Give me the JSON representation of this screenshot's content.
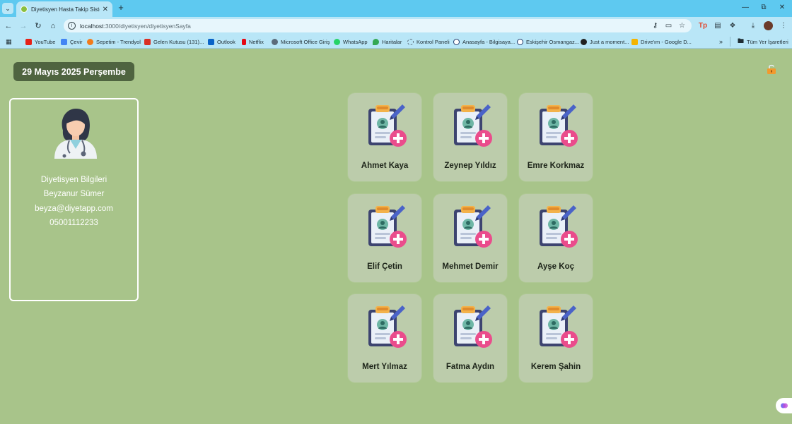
{
  "browser": {
    "tab_title": "Diyetisyen Hasta Takip Sistemi",
    "url_host": "localhost",
    "url_path": ":3000/diyetisyen/diyetisyenSayfa",
    "bookmarks": [
      {
        "label": "YouTube",
        "color": "#e62117"
      },
      {
        "label": "Çevir",
        "color": "#4285f4"
      },
      {
        "label": "Sepetim - Trendyol",
        "color": "#f27a1a"
      },
      {
        "label": "Gelen Kutusu (131)...",
        "color": "#d93025"
      },
      {
        "label": "Outlook",
        "color": "#0a64c8"
      },
      {
        "label": "Netflix",
        "color": "#e50914"
      },
      {
        "label": "Microsoft Office Giriş",
        "color": "#5b6b7a"
      },
      {
        "label": "WhatsApp",
        "color": "#25d366"
      },
      {
        "label": "Haritalar",
        "color": "#34a853"
      },
      {
        "label": "Kontrol Paneli",
        "color": "#5b6b7a"
      },
      {
        "label": "Anasayfa - Bilgisaya...",
        "color": "#203a6b"
      },
      {
        "label": "Eskişehir Osmangaz...",
        "color": "#203a6b"
      },
      {
        "label": "Just a moment...",
        "color": "#222222"
      },
      {
        "label": "Drive'ım - Google D...",
        "color": "#f4b400"
      }
    ],
    "all_bookmarks_label": "Tüm Yer İşaretleri"
  },
  "page": {
    "date": "29 Mayıs 2025 Perşembe",
    "dietitian": {
      "heading": "Diyetisyen Bilgileri",
      "name": "Beyzanur Sümer",
      "email": "beyza@diyetapp.com",
      "phone": "05001112233"
    },
    "patients": [
      {
        "name": "Ahmet Kaya"
      },
      {
        "name": "Zeynep Yıldız"
      },
      {
        "name": "Emre Korkmaz"
      },
      {
        "name": "Elif Çetin"
      },
      {
        "name": "Mehmet Demir"
      },
      {
        "name": "Ayşe Koç"
      },
      {
        "name": "Mert Yılmaz"
      },
      {
        "name": "Fatma Aydın"
      },
      {
        "name": "Kerem Şahin"
      }
    ]
  }
}
